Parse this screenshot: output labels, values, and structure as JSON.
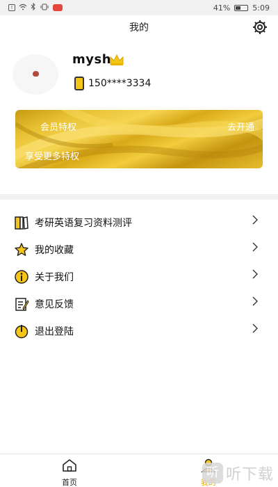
{
  "status_bar": {
    "battery_pct": "41%",
    "time": "5:09"
  },
  "header": {
    "title": "我的"
  },
  "profile": {
    "username": "mysh",
    "phone": "150****3334"
  },
  "member_banner": {
    "title": "会员特权",
    "subtitle": "享受更多特权",
    "action": "去开通"
  },
  "menu": {
    "items": [
      {
        "label": "考研英语复习资料测评",
        "icon": "book-icon"
      },
      {
        "label": "我的收藏",
        "icon": "star-icon"
      },
      {
        "label": "关于我们",
        "icon": "info-icon"
      },
      {
        "label": "意见反馈",
        "icon": "feedback-icon"
      },
      {
        "label": "退出登陆",
        "icon": "power-icon"
      }
    ]
  },
  "bottom_nav": {
    "home_label": "首页",
    "mine_label": "我的",
    "active": "mine"
  },
  "watermark": {
    "logo": "听",
    "text": "听下载"
  },
  "colors": {
    "accent": "#f5c518",
    "active_nav": "#e0a800",
    "divider": "#f1f1f1"
  }
}
